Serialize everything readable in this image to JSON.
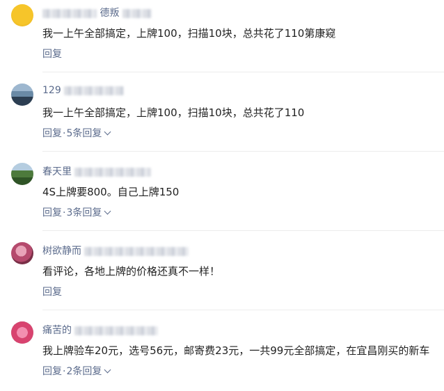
{
  "comments": [
    {
      "name_visible": "德叛",
      "text": "我一上午全部搞定，上牌100，扫描10块，总共花了110第康窥",
      "reply": "回复",
      "replies_count": ""
    },
    {
      "name_visible": "129",
      "text": "我一上午全部搞定，上牌100，扫描10块，总共花了110",
      "reply": "回复",
      "replies_count": "5条回复"
    },
    {
      "name_visible": "春天里",
      "text": "4S上牌要800。自己上牌150",
      "reply": "回复",
      "replies_count": "3条回复"
    },
    {
      "name_visible": "树欲静而",
      "text": "看评论，各地上牌的价格还真不一样！",
      "reply": "回复",
      "replies_count": ""
    },
    {
      "name_visible": "痛苦的",
      "text": "我上牌验车20元，选号56元，邮寄费23元，一共99元全部搞定，在宜昌刚买的新车",
      "reply": "回复",
      "replies_count": "2条回复"
    }
  ],
  "dot": "·",
  "colors": {
    "link": "#5b6b8c",
    "text": "#222222",
    "divider": "#ececec"
  }
}
